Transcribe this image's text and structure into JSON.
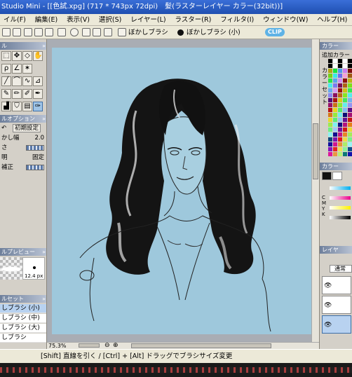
{
  "titlebar": {
    "text": "Studio Mini - [[色試.xpg] (717 * 743px 72dpi)　髪(ラスターレイヤー カラー(32bit))]"
  },
  "menubar": {
    "items": [
      "イル(F)",
      "編集(E)",
      "表示(V)",
      "選択(S)",
      "レイヤー(L)",
      "ラスター(R)",
      "フィルタ(I)",
      "ウィンドウ(W)",
      "ヘルプ(H)"
    ]
  },
  "toolbar": {
    "brush_label_1": "ぼかしブラシ",
    "brush_label_2": "ぼかしブラシ (小)",
    "badge": "CLIP"
  },
  "left_panel": {
    "tools_title": "ル",
    "options_title": "ルオプション",
    "reset_label": "初期設定",
    "options": [
      {
        "label": "かし幅",
        "value": "2.0"
      },
      {
        "label": "さ",
        "value": ""
      },
      {
        "label": "明",
        "value": "固定"
      },
      {
        "label": "補正",
        "value": ""
      }
    ],
    "preview_title": "ルプレビュー",
    "preview_size": "12.4 px",
    "presets_title": "ルセット",
    "presets": [
      "しブラシ (小)",
      "しブラシ (中)",
      "しブラシ (大)",
      "しブラシ"
    ]
  },
  "canvas": {
    "zoom": "75.3%",
    "background_color": "#9ec8dc"
  },
  "right_panel": {
    "color_title": "カラー",
    "add_color_label": "追加カラー",
    "set_label": "カラーセット",
    "color_title2": "カラー",
    "cmyk_label": "CMYK",
    "layer_title": "レイヤ",
    "layer_mode": "通常"
  },
  "status": {
    "text": "[Shift] 直線を引く / [Ctrl] + [Alt] ドラッグでブラシサイズ変更"
  }
}
